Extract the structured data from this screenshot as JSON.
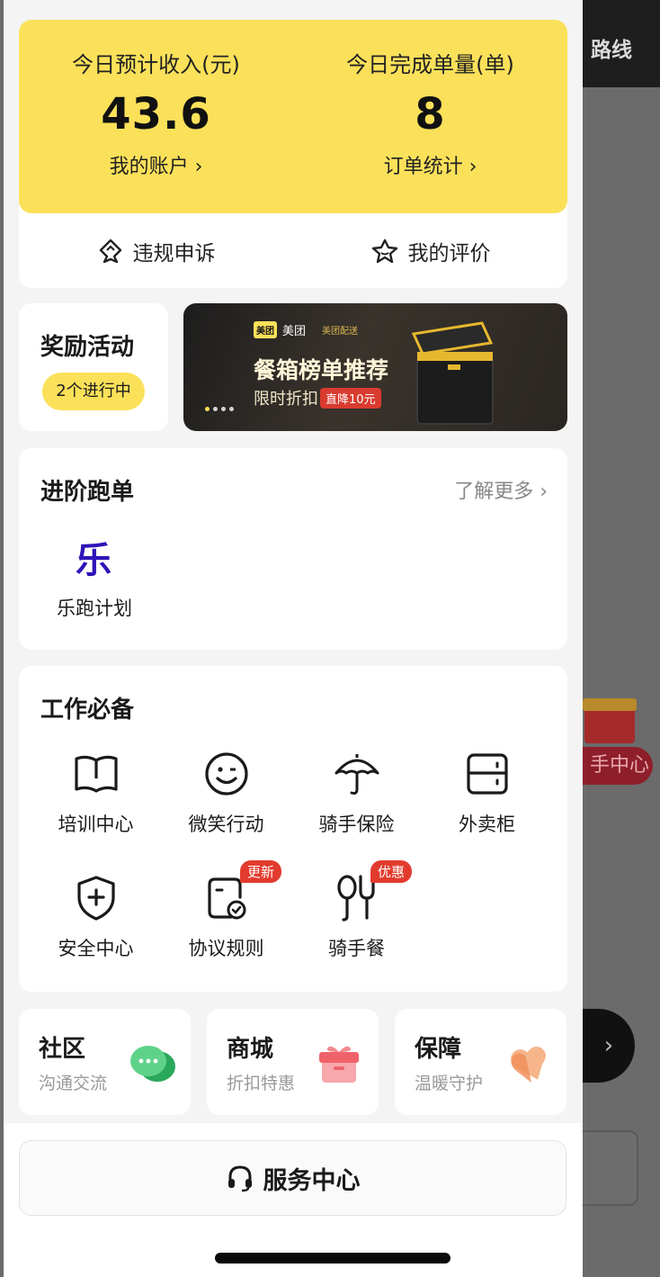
{
  "background": {
    "route_label": "路线",
    "pill_label": "手中心",
    "arrow": "›"
  },
  "income": {
    "left": {
      "label": "今日预计收入(元)",
      "value": "43.6",
      "link": "我的账户 ›"
    },
    "right": {
      "label": "今日完成单量(单)",
      "value": "8",
      "link": "订单统计 ›"
    },
    "quick_actions": [
      {
        "label": "违规申诉",
        "icon": "appeal-icon"
      },
      {
        "label": "我的评价",
        "icon": "star-icon"
      }
    ]
  },
  "reward": {
    "title": "奖励活动",
    "badge": "2个进行中"
  },
  "banner": {
    "brand": "美团",
    "brand_logo": "美团",
    "partner": "美团配送",
    "title": "餐箱榜单推荐",
    "subtitle": "限时折扣",
    "tag": "直降10元",
    "accent": "#fbe15a"
  },
  "advance": {
    "title": "进阶跑单",
    "more": "了解更多 ›",
    "item_icon_text": "乐",
    "item_label": "乐跑计划"
  },
  "tools": {
    "title": "工作必备",
    "items": [
      {
        "label": "培训中心",
        "icon": "book-icon",
        "badge": ""
      },
      {
        "label": "微笑行动",
        "icon": "smile-icon",
        "badge": ""
      },
      {
        "label": "骑手保险",
        "icon": "umbrella-icon",
        "badge": ""
      },
      {
        "label": "外卖柜",
        "icon": "locker-icon",
        "badge": ""
      },
      {
        "label": "安全中心",
        "icon": "shield-icon",
        "badge": ""
      },
      {
        "label": "协议规则",
        "icon": "document-check-icon",
        "badge": "更新"
      },
      {
        "label": "骑手餐",
        "icon": "spoon-fork-icon",
        "badge": "优惠"
      }
    ]
  },
  "mini_cards": [
    {
      "title": "社区",
      "subtitle": "沟通交流",
      "icon": "chat-bubble-icon",
      "color": "#3cc06a"
    },
    {
      "title": "商城",
      "subtitle": "折扣特惠",
      "icon": "gift-box-icon",
      "color": "#f0626a"
    },
    {
      "title": "保障",
      "subtitle": "温暖守护",
      "icon": "heart-icon",
      "color": "#f09a5a"
    }
  ],
  "service": {
    "label": "服务中心",
    "icon": "headset-icon"
  },
  "colors": {
    "brand_yellow": "#fbe15a",
    "badge_red": "#e23b2e",
    "lepao_blue": "#2f14b8"
  }
}
